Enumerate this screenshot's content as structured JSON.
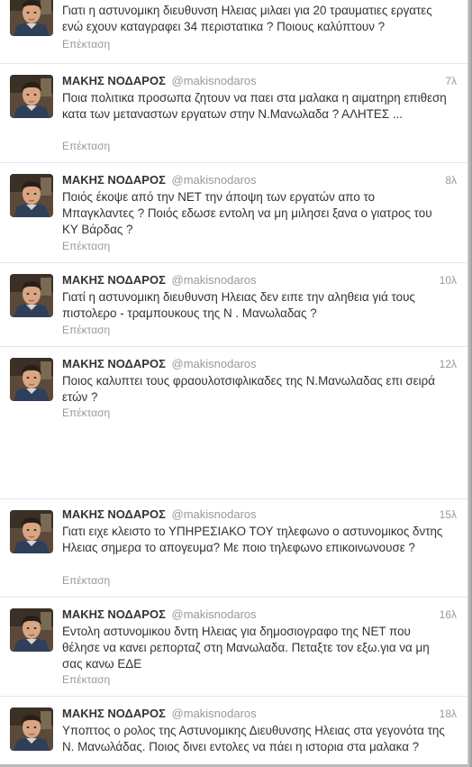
{
  "tweets": [
    {
      "name": "",
      "handle": "",
      "time": "",
      "text": "Γιατι η αστυνομικη διευθυνση Ηλειας μιλαει για 20 τραυματιες εργατες ενώ εχουν καταγραφει 34 περιστατικα ? Ποιους καλύπτουν ?",
      "expand": "Επέκταση"
    },
    {
      "name": "ΜΑΚΗΣ ΝΟΔΑΡΟΣ",
      "handle": "@makisnodaros",
      "time": "7λ",
      "text": "Ποια πολιτικα προσωπα ζητουν να παει στα μαλακα η αιματηρη επιθεση κατα των μεταναστων εργατων στην  Ν.Μανωλαδα ? ΑΛΗΤΕΣ ...",
      "expand": "Επέκταση"
    },
    {
      "name": "ΜΑΚΗΣ ΝΟΔΑΡΟΣ",
      "handle": "@makisnodaros",
      "time": "8λ",
      "text": "Ποιός έκοψε από την ΝΕΤ την άποψη των εργατών απο το Μπαγκλαντες ? Ποιός εδωσε εντολη να μη μιλησει ξανα ο γιατρος του ΚΥ Βάρδας ?",
      "expand": "Επέκταση"
    },
    {
      "name": "ΜΑΚΗΣ ΝΟΔΑΡΟΣ",
      "handle": "@makisnodaros",
      "time": "10λ",
      "text": "Γιατί η αστυνομικη διευθυνση Ηλειας δεν ειπε την αληθεια γιά τους πιστολερο - τραμπουκους της Ν . Μανωλαδας ?",
      "expand": "Επέκταση"
    },
    {
      "name": "ΜΑΚΗΣ ΝΟΔΑΡΟΣ",
      "handle": "@makisnodaros",
      "time": "12λ",
      "text": "Ποιος καλυπτει τους φραουλοτσιφλικαδες της Ν.Μανωλαδας επι σειρά ετών ?",
      "expand": "Επέκταση"
    },
    {
      "name": "ΜΑΚΗΣ ΝΟΔΑΡΟΣ",
      "handle": "@makisnodaros",
      "time": "15λ",
      "text": "Γιατι ειχε κλειστο το ΥΠΗΡΕΣΙΑΚΟ ΤΟΥ τηλεφωνο ο αστυνομικος δντης Ηλειας σημερα το απογευμα? Με ποιο τηλεφωνο επικοινωνουσε ?",
      "expand": "Επέκταση"
    },
    {
      "name": "ΜΑΚΗΣ ΝΟΔΑΡΟΣ",
      "handle": "@makisnodaros",
      "time": "16λ",
      "text": "Εντολη αστυνομικου δντη Ηλειας για δημοσιογραφο της ΝΕΤ που θέλησε να κανει ρεπορταζ στη Μανωλαδα. Πεταξτε τον εξω.για να μη σας κανω ΕΔΕ",
      "expand": "Επέκταση"
    },
    {
      "name": "ΜΑΚΗΣ ΝΟΔΑΡΟΣ",
      "handle": "@makisnodaros",
      "time": "18λ",
      "text": "Υποπτος ο ρολος της Αστυνομικης Διευθυνσης Ηλειας στα γεγονότα της Ν. Μανωλάδας. Ποιος δινει εντολες να πάει η ιστορια στα μαλακα ?",
      "expand": ""
    }
  ]
}
